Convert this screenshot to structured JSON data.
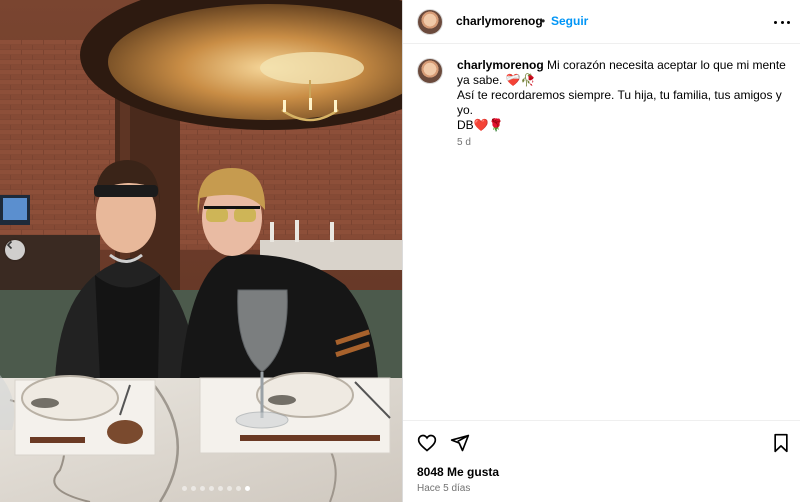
{
  "post": {
    "username": "charlymorenog",
    "separator": "•",
    "follow_label": "Seguir",
    "more_icon": "more-options-icon",
    "photo": {
      "carousel_dots": 8,
      "active_dot": 7,
      "prev_icon": "chevron-left-icon"
    }
  },
  "caption": {
    "username": "charlymorenog",
    "line1": "Mi corazón necesita aceptar lo que mi mente ya sabe. ❤️‍🩹🥀",
    "line2": "Así te recordaremos siempre. Tu hija, tu familia, tus amigos y yo.",
    "line3": "DB❤️🌹",
    "time": "5 d"
  },
  "actions": {
    "like_icon": "heart-icon",
    "share_icon": "share-icon",
    "save_icon": "bookmark-icon",
    "likes_text": "8048 Me gusta",
    "date_text": "Hace 5 días"
  }
}
